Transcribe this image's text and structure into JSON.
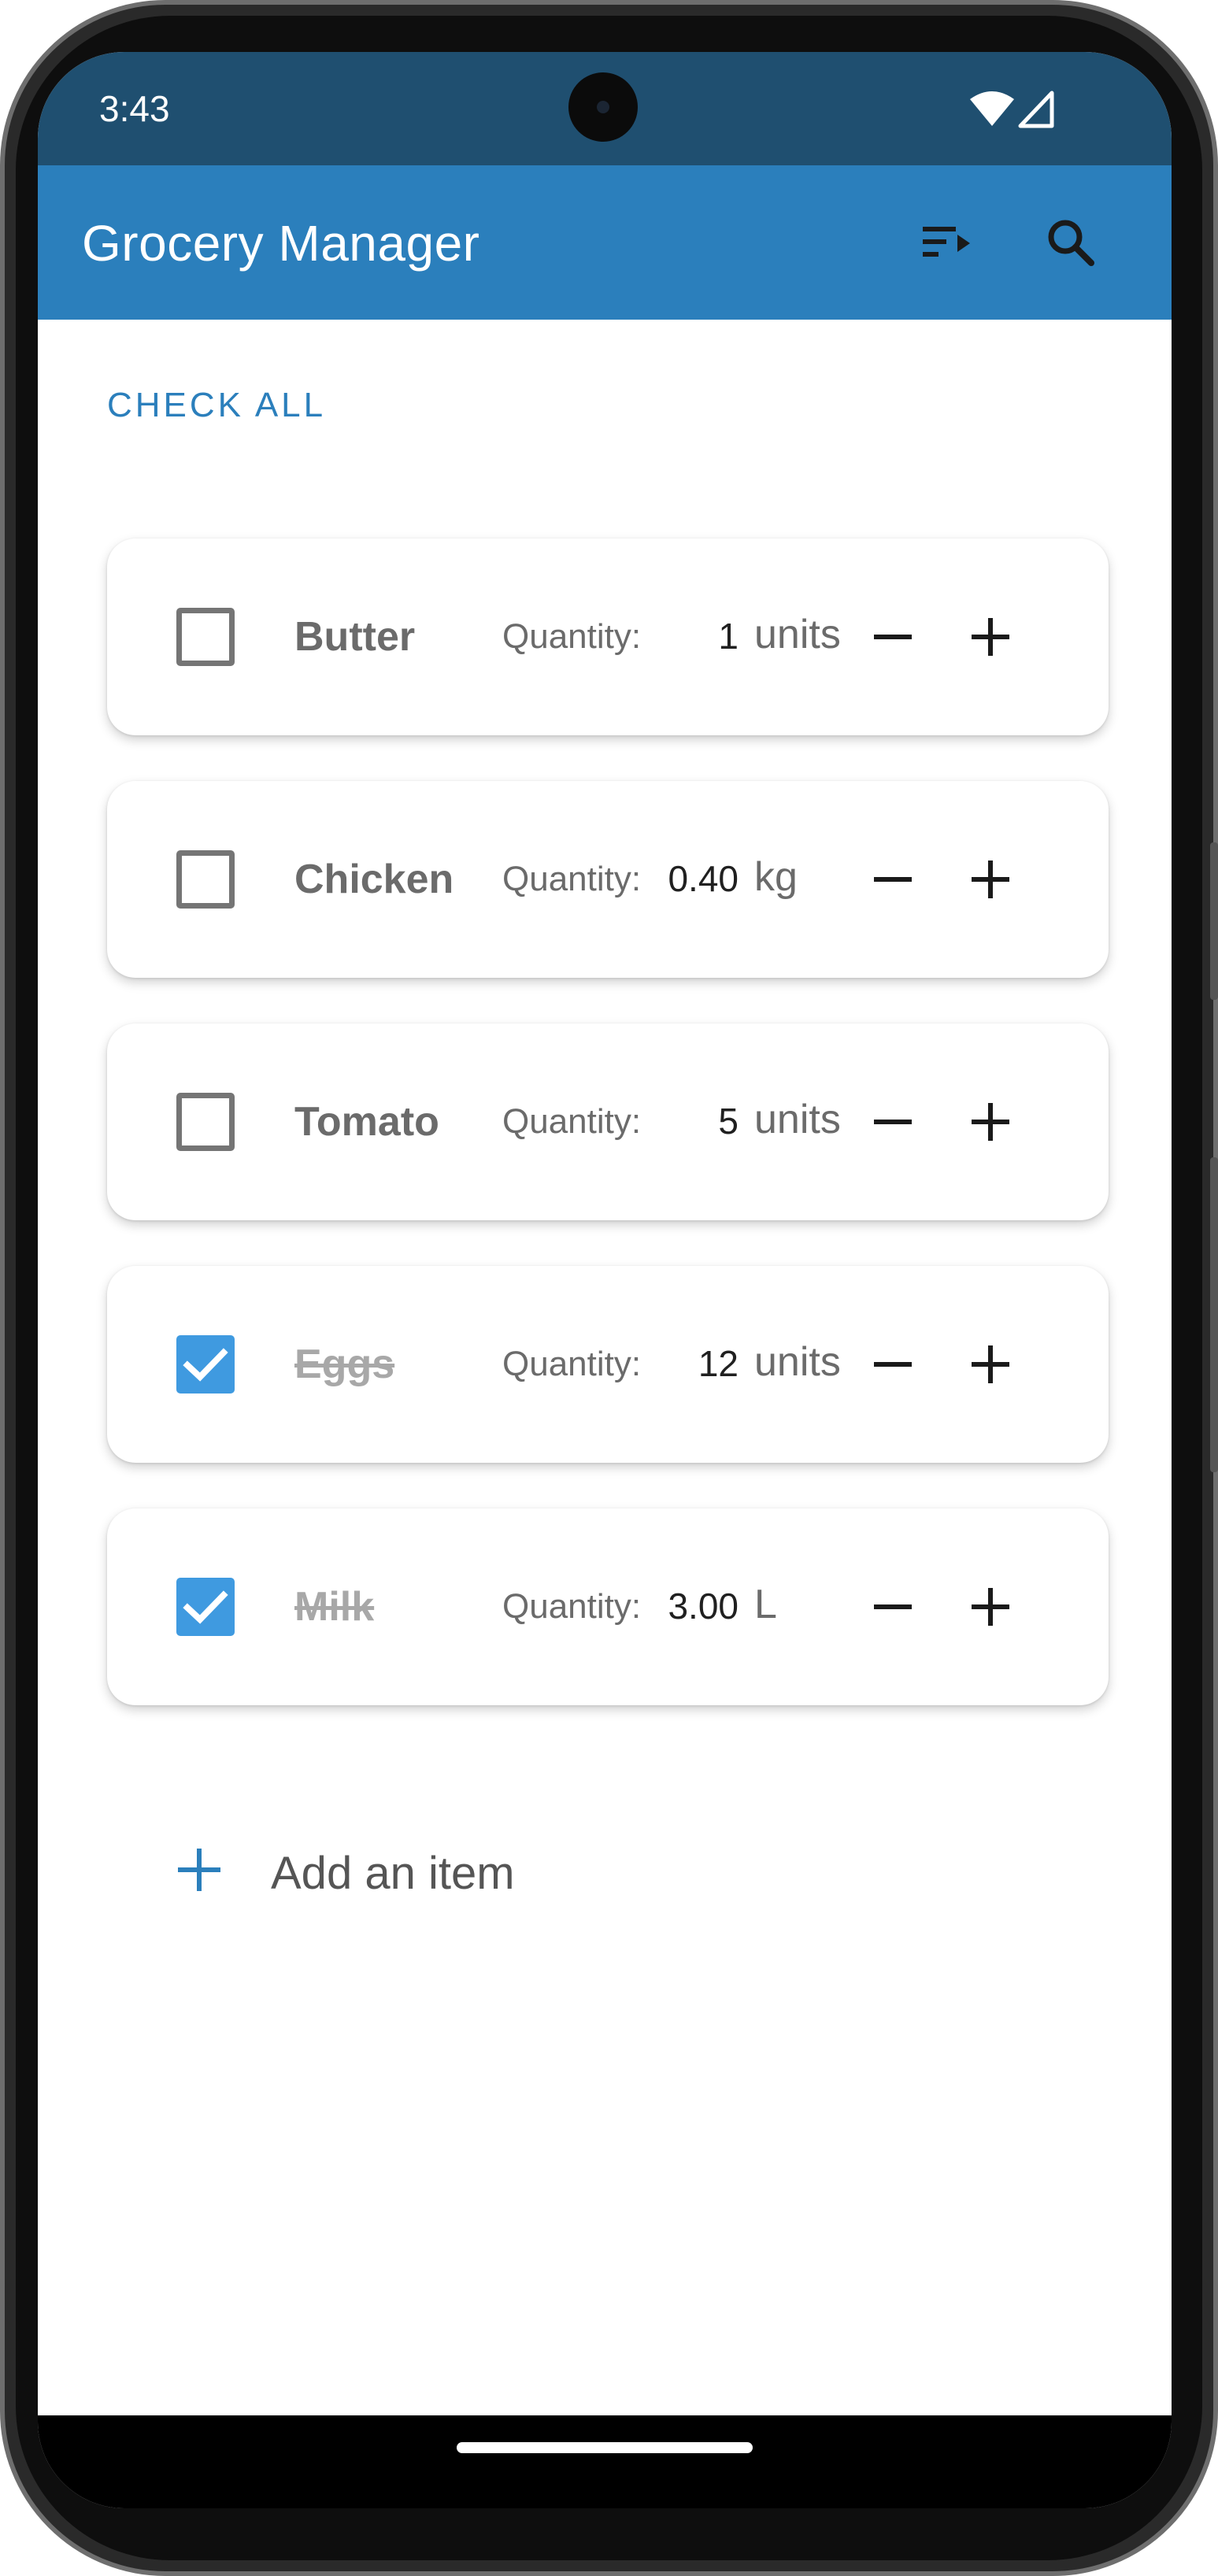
{
  "status_bar": {
    "time": "3:43",
    "icons": [
      "wifi-icon",
      "cell-signal-icon"
    ],
    "color": "#1f4f70"
  },
  "app_bar": {
    "title": "Grocery Manager",
    "actions": [
      "sort-icon",
      "search-icon"
    ],
    "color": "#2b7fbc"
  },
  "toolbar": {
    "check_all_label": "CHECK ALL"
  },
  "items": [
    {
      "name": "Butter",
      "quantity_label": "Quantity:",
      "quantity": "1",
      "unit": "units",
      "checked": false
    },
    {
      "name": "Chicken",
      "quantity_label": "Quantity:",
      "quantity": "0.40",
      "unit": "kg",
      "checked": false
    },
    {
      "name": "Tomato",
      "quantity_label": "Quantity:",
      "quantity": "5",
      "unit": "units",
      "checked": false
    },
    {
      "name": "Eggs",
      "quantity_label": "Quantity:",
      "quantity": "12",
      "unit": "units",
      "checked": true
    },
    {
      "name": "Milk",
      "quantity_label": "Quantity:",
      "quantity": "3.00",
      "unit": "L",
      "checked": true
    }
  ],
  "add_item": {
    "label": "Add an item",
    "icon": "plus-icon"
  },
  "colors": {
    "accent": "#2b7fbc",
    "checkbox_checked": "#3f9ae0"
  }
}
